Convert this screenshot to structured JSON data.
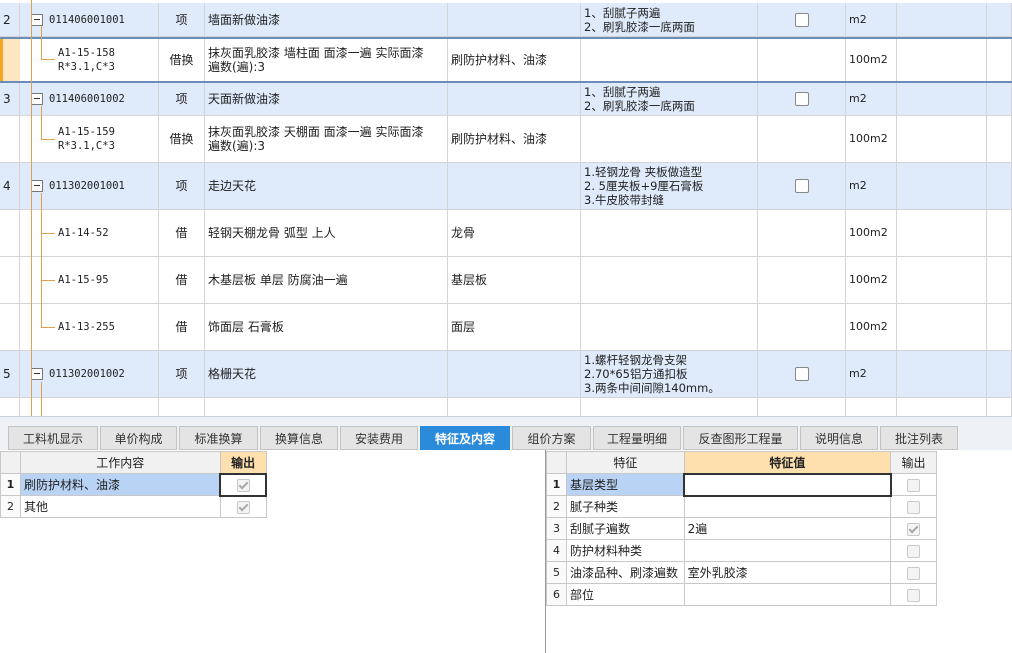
{
  "grid": {
    "rows": [
      {
        "num": "2",
        "code": "011406001001",
        "type": "项",
        "name": "墙面新做油漆",
        "content": "",
        "feat1": "1、刮腻子两遍",
        "feat2": "2、刷乳胶漆一底两面",
        "feat3": "",
        "unit": "m2"
      },
      {
        "num": "",
        "code1": "A1-15-158",
        "code2": "R*3.1,C*3",
        "type": "借换",
        "name1": "抹灰面乳胶漆 墙柱面 面漆一遍  实际面漆",
        "name2": "遍数(遍):3",
        "content": "刷防护材料、油漆",
        "unit": "100m2"
      },
      {
        "num": "3",
        "code": "011406001002",
        "type": "项",
        "name": "天面新做油漆",
        "content": "",
        "feat1": "1、刮腻子两遍",
        "feat2": "2、刷乳胶漆一底两面",
        "feat3": "",
        "unit": "m2"
      },
      {
        "num": "",
        "code1": "A1-15-159",
        "code2": "R*3.1,C*3",
        "type": "借换",
        "name1": "抹灰面乳胶漆 天棚面 面漆一遍  实际面漆",
        "name2": "遍数(遍):3",
        "content": "刷防护材料、油漆",
        "unit": "100m2"
      },
      {
        "num": "4",
        "code": "011302001001",
        "type": "项",
        "name": "走边天花",
        "content": "",
        "feat1": "1.轻钢龙骨 夹板做造型",
        "feat2": "2. 5厘夹板+9厘石膏板",
        "feat3": "3.牛皮胶带封缝",
        "unit": "m2"
      },
      {
        "num": "",
        "code1": "A1-14-52",
        "code2": "",
        "type": "借",
        "name1": "轻钢天棚龙骨 弧型 上人",
        "name2": "",
        "content": "龙骨",
        "unit": "100m2"
      },
      {
        "num": "",
        "code1": "A1-15-95",
        "code2": "",
        "type": "借",
        "name1": "木基层板 单层 防腐油一遍",
        "name2": "",
        "content": "基层板",
        "unit": "100m2"
      },
      {
        "num": "",
        "code1": "A1-13-255",
        "code2": "",
        "type": "借",
        "name1": "饰面层 石膏板",
        "name2": "",
        "content": "面层",
        "unit": "100m2"
      },
      {
        "num": "5",
        "code": "011302001002",
        "type": "项",
        "name": "格栅天花",
        "content": "",
        "feat1": "1.螺杆轻钢龙骨支架",
        "feat2": "2.70*65铝方通扣板",
        "feat3": "3.两条中间间隙140mm。",
        "unit": "m2"
      }
    ]
  },
  "tabs": [
    "工料机显示",
    "单价构成",
    "标准换算",
    "换算信息",
    "安装费用",
    "特征及内容",
    "组价方案",
    "工程量明细",
    "反查图形工程量",
    "说明信息",
    "批注列表"
  ],
  "left_table": {
    "header_content": "工作内容",
    "header_output": "输出",
    "rows": [
      {
        "num": "1",
        "content": "刷防护材料、油漆",
        "checked": true
      },
      {
        "num": "2",
        "content": "其他",
        "checked": true
      }
    ]
  },
  "right_table": {
    "header_feature": "特征",
    "header_value": "特征值",
    "header_output": "输出",
    "rows": [
      {
        "num": "1",
        "feature": "基层类型",
        "value": "",
        "checked": false
      },
      {
        "num": "2",
        "feature": "腻子种类",
        "value": "",
        "checked": false
      },
      {
        "num": "3",
        "feature": "刮腻子遍数",
        "value": "2遍",
        "checked": true
      },
      {
        "num": "4",
        "feature": "防护材料种类",
        "value": "",
        "checked": false
      },
      {
        "num": "5",
        "feature": "油漆品种、刷漆遍数",
        "value": "室外乳胶漆",
        "checked": false
      },
      {
        "num": "6",
        "feature": "部位",
        "value": "",
        "checked": false
      }
    ]
  },
  "colors": {
    "item_row": "#dfeafb",
    "active_tab": "#2b8ad9",
    "tree_line": "#e0a050",
    "selected_marker": "#f5a623"
  }
}
